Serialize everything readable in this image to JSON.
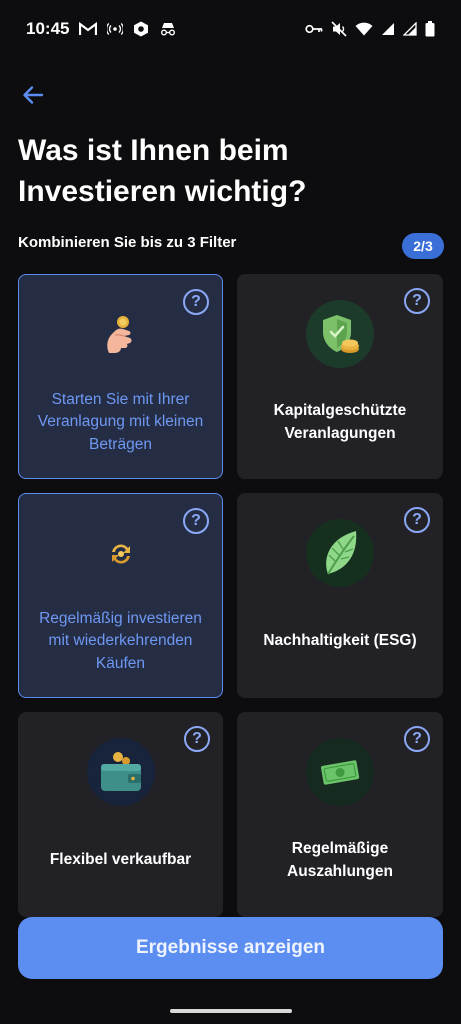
{
  "status_bar": {
    "time": "10:45",
    "icons_left": [
      "gmail-icon",
      "radio-icon",
      "app-icon",
      "incognito-icon"
    ],
    "icons_right": [
      "key-icon",
      "mute-icon",
      "wifi-icon",
      "signal-icon",
      "signal-icon-2",
      "battery-icon"
    ]
  },
  "header": {
    "back_icon": "arrow-left-icon",
    "title": "Was ist Ihnen beim Investieren wichtig?",
    "subtitle": "Kombinieren Sie bis zu 3 Filter",
    "step": "2/3"
  },
  "filters": [
    {
      "label": "Starten Sie mit Ihrer Veranlagung mit kleinen Beträgen",
      "selected": true,
      "icon": "hand-coin-icon"
    },
    {
      "label": "Kapitalgeschützte Veranlagungen",
      "selected": false,
      "icon": "shield-coins-icon"
    },
    {
      "label": "Regelmäßig investieren mit wiederkehrenden Käufen",
      "selected": true,
      "icon": "recurring-coins-icon"
    },
    {
      "label": "Nachhaltigkeit (ESG)",
      "selected": false,
      "icon": "leaf-icon"
    },
    {
      "label": "Flexibel verkaufbar",
      "selected": false,
      "icon": "wallet-icon"
    },
    {
      "label": "Regelmäßige Auszahlungen",
      "selected": false,
      "icon": "banknote-icon"
    }
  ],
  "help_label": "?",
  "cta_label": "Ergebnisse anzeigen",
  "colors": {
    "background": "#0d0d0f",
    "card": "#222226",
    "card_selected": "#252d45",
    "accent": "#5b8ef0"
  }
}
